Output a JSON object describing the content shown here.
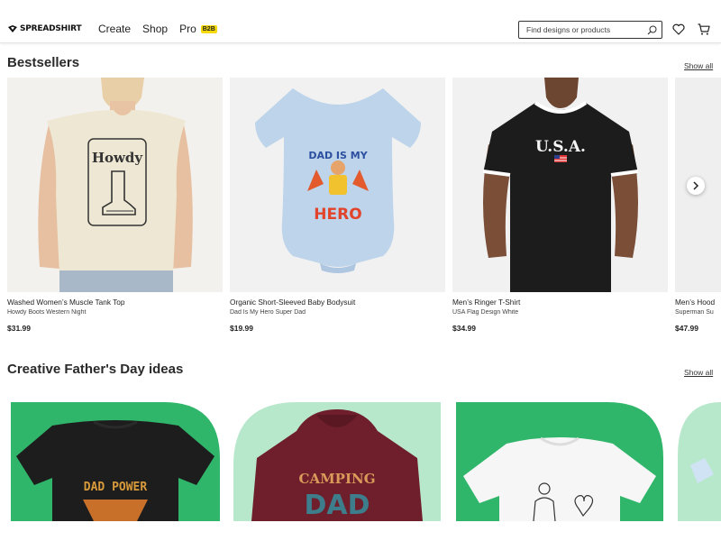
{
  "header": {
    "logo_text": "SPREADSHIRT",
    "nav": [
      {
        "label": "Create"
      },
      {
        "label": "Shop"
      },
      {
        "label": "Pro",
        "badge": "B2B"
      }
    ],
    "search_placeholder": "Find designs or products",
    "icons": [
      "search-icon",
      "heart-icon",
      "cart-icon"
    ]
  },
  "bestsellers": {
    "title": "Bestsellers",
    "show_all": "Show all",
    "products": [
      {
        "title": "Washed Women’s Muscle Tank Top",
        "subtitle": "Howdy Boots Western Night",
        "price": "$31.99",
        "print": "Howdy"
      },
      {
        "title": "Organic Short-Sleeved Baby Bodysuit",
        "subtitle": "Dad Is My Hero Super Dad",
        "price": "$19.99",
        "print_top": "DAD IS MY",
        "print_bottom": "HERO"
      },
      {
        "title": "Men’s Ringer T-Shirt",
        "subtitle": "USA Flag Design White",
        "price": "$34.99",
        "print": "U.S.A."
      },
      {
        "title": "Men’s Hood",
        "subtitle": "Superman Su",
        "price": "$47.99"
      }
    ]
  },
  "fathers_day": {
    "title": "Creative Father's Day ideas",
    "show_all": "Show all",
    "items": [
      {
        "print": "DAD POWER"
      },
      {
        "print_top": "CAMPING",
        "print_bottom": "DAD"
      },
      {
        "print": ""
      }
    ]
  },
  "colors": {
    "brand_green": "#2fb66a",
    "mint": "#b8e8cc",
    "badge_yellow": "#f5d90a"
  }
}
